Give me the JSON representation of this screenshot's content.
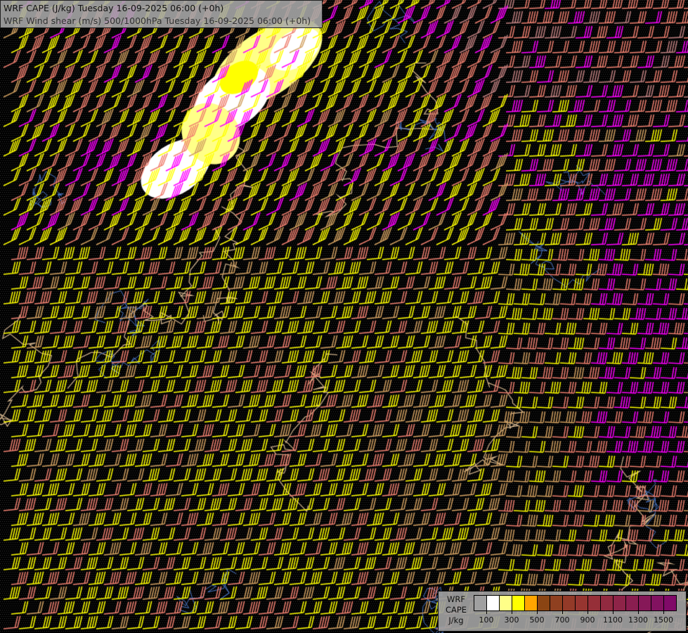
{
  "header": {
    "line1": "WRF CAPE (J/kg) Tuesday 16-09-2025 06:00 (+0h)",
    "line2": "WRF Wind shear (m/s) 500/1000hPa Tuesday 16-09-2025 06:00 (+0h)"
  },
  "legend": {
    "title_lines": [
      "WRF",
      "CAPE",
      "J/kg"
    ],
    "colors": [
      "#a0a0a0",
      "#ffffff",
      "#ffff88",
      "#ffff00",
      "#ffa500",
      "#8b4513",
      "#8f4020",
      "#933a28",
      "#973530",
      "#962f38",
      "#922a40",
      "#8e2448",
      "#8a1e50",
      "#861858",
      "#821260",
      "#800a68"
    ],
    "labels": [
      "100",
      "300",
      "500",
      "700",
      "900",
      "1100",
      "1300",
      "1500"
    ]
  },
  "barb_colors": [
    "#ffff00",
    "#f08070",
    "#d2a060",
    "#ff00ff",
    "#c08080"
  ]
}
